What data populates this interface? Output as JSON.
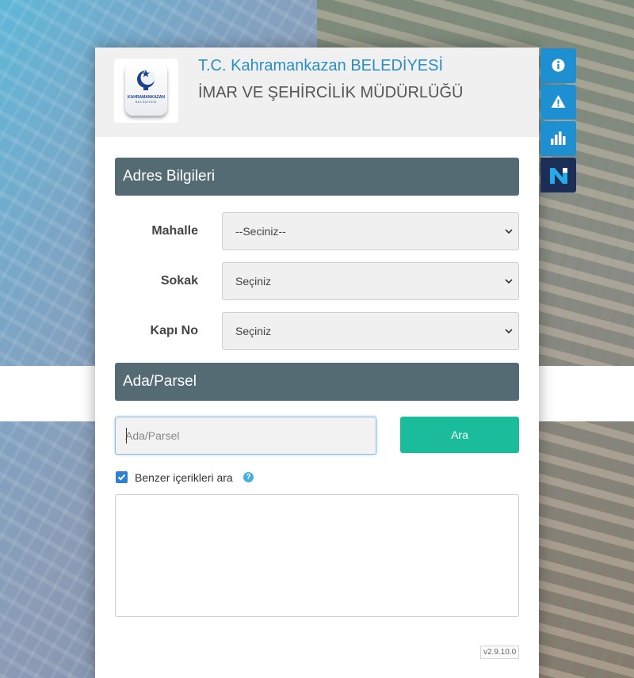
{
  "header": {
    "title": "T.C. Kahramankazan BELEDİYESİ",
    "subtitle": "İMAR VE ŞEHİRCİLİK MÜDÜRLÜĞÜ",
    "logo_text": "KAHRAMANKAZAN",
    "logo_subtext": "BELEDİYESİ"
  },
  "address_section": {
    "title": "Adres Bilgileri",
    "fields": [
      {
        "label": "Mahalle",
        "value": "--Seciniz--"
      },
      {
        "label": "Sokak",
        "value": "Seçiniz"
      },
      {
        "label": "Kapı No",
        "value": "Seçiniz"
      }
    ]
  },
  "parcel_section": {
    "title": "Ada/Parsel",
    "input_placeholder": "Ada/Parsel",
    "input_value": "",
    "search_label": "Ara"
  },
  "similar": {
    "label": "Benzer içerikleri ara",
    "checked": true
  },
  "version": "v2.9.10.0",
  "side_toolbar": [
    "info-icon",
    "warning-icon",
    "bar-chart-icon",
    "brand-logo-icon"
  ],
  "colors": {
    "accent": "#1e90d2",
    "section_bg": "#546b74",
    "button_bg": "#1abc9c",
    "title_color": "#2a8fc4"
  }
}
